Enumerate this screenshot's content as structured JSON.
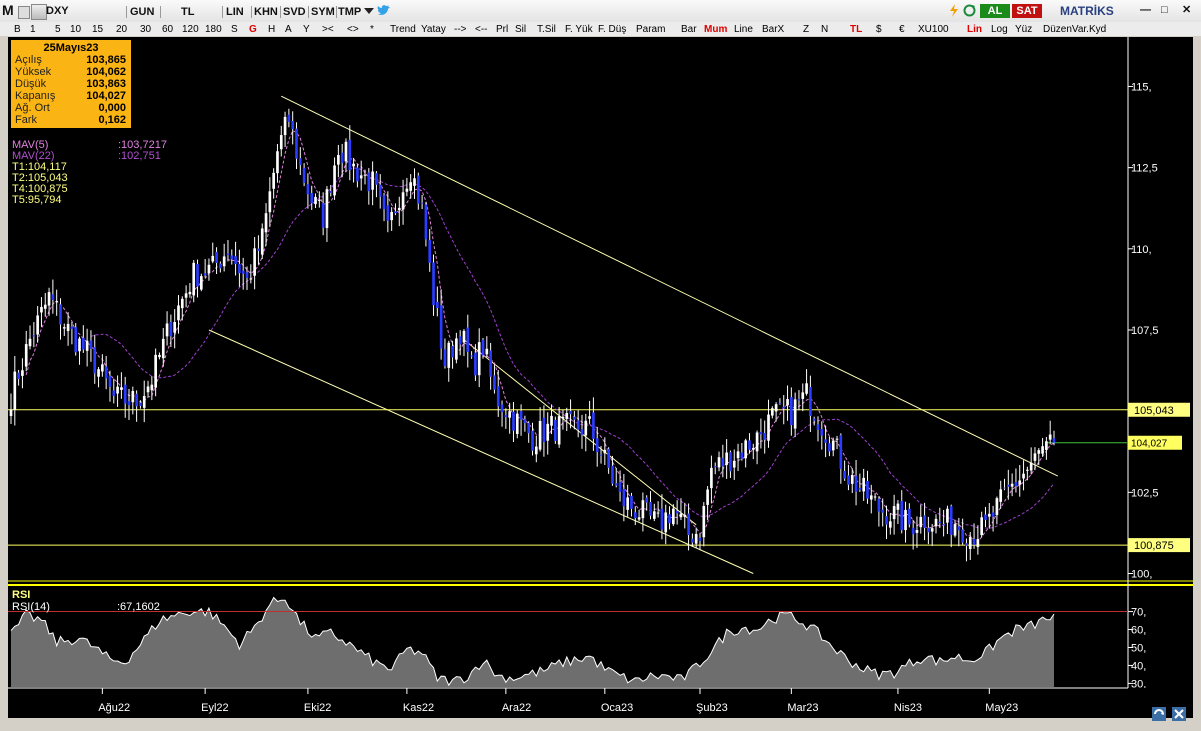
{
  "app": {
    "name": "MATRİKS",
    "symbol": "DXY",
    "period": "GUN",
    "currency": "TL",
    "scale": "LIN"
  },
  "titlebar_buttons": [
    "GUN",
    "TL",
    "LIN",
    "KHN",
    "SVD",
    "SYM",
    "TMP"
  ],
  "trade": {
    "buy": "AL",
    "sell": "SAT"
  },
  "window_controls": {
    "minimize": "—",
    "maximize": "□",
    "close": "✕"
  },
  "toolbar": [
    "B",
    "1",
    "5",
    "10",
    "15",
    "20",
    "30",
    "60",
    "120",
    "180",
    "S",
    "G",
    "H",
    "A",
    "Y",
    ">< ",
    "<>",
    "*",
    "Trend",
    "Yatay",
    "-->",
    "<--",
    "Prl",
    "Sil",
    "T.Sil",
    "F. Yük",
    "F. Düş",
    "Param",
    "Bar",
    "Mum",
    "Line",
    "BarX",
    "Z",
    "N",
    "TL",
    "$",
    "€",
    "XU100",
    "Lin",
    "Log",
    "Yüz",
    "DüzenVar.Kyd"
  ],
  "toolbar_colors": {
    "active_red": "#e00000",
    "accent_green": "#00a000",
    "accent_red": "#c00000"
  },
  "ohlc": {
    "date": "25Mayıs23",
    "rows": [
      {
        "label": "Açılış",
        "value": "103,865"
      },
      {
        "label": "Yüksek",
        "value": "104,062"
      },
      {
        "label": "Düşük",
        "value": "103,863"
      },
      {
        "label": "Kapanış",
        "value": "104,027"
      },
      {
        "label": "Ağ. Ort",
        "value": "0,000"
      },
      {
        "label": "Fark",
        "value": "0,162"
      }
    ]
  },
  "indicators": {
    "mav5": {
      "label": "MAV(5)",
      "value": ":103,7217",
      "color": "#e080e0"
    },
    "mav22": {
      "label": "MAV(22)",
      "value": ":102,751",
      "color": "#b050d0"
    },
    "targets": [
      "T1:104,117",
      "T2:105,043",
      "T4:100,875",
      "T5:95,794"
    ]
  },
  "chart_data": {
    "type": "candlestick",
    "symbol": "DXY",
    "ylim": [
      99.8,
      116.4
    ],
    "yticks": [
      "115,",
      "112,5",
      "110,",
      "107,5",
      "105,",
      "102,5",
      "100,"
    ],
    "ytick_values": [
      115,
      112.5,
      110,
      107.5,
      105,
      102.5,
      100
    ],
    "xticks": [
      "Ağu22",
      "Eyl22",
      "Eki22",
      "Kas22",
      "Ara22",
      "Oca23",
      "Şub23",
      "Mar23",
      "Nis23",
      "May23"
    ],
    "xtick_index": [
      24,
      51,
      78,
      104,
      130,
      156,
      181,
      205,
      233,
      257
    ],
    "num_bars": 275,
    "last_close": "104,027",
    "levels": [
      {
        "label": "105,043",
        "value": 105.043
      },
      {
        "label": "100,875",
        "value": 100.875
      }
    ],
    "key_points": [
      [
        0,
        105.5
      ],
      [
        5,
        107.2
      ],
      [
        10,
        108.5
      ],
      [
        15,
        107.5
      ],
      [
        22,
        106.5
      ],
      [
        27,
        105.4
      ],
      [
        33,
        105.3
      ],
      [
        37,
        106.0
      ],
      [
        42,
        107.7
      ],
      [
        48,
        109.2
      ],
      [
        53,
        109.4
      ],
      [
        57,
        110.0
      ],
      [
        62,
        109.0
      ],
      [
        66,
        110.3
      ],
      [
        70,
        113.0
      ],
      [
        73,
        114.0
      ],
      [
        76,
        112.5
      ],
      [
        79,
        111.5
      ],
      [
        82,
        111.0
      ],
      [
        86,
        113.2
      ],
      [
        90,
        112.5
      ],
      [
        95,
        112.0
      ],
      [
        99,
        110.5
      ],
      [
        102,
        111.7
      ],
      [
        105,
        112.5
      ],
      [
        108,
        111.2
      ],
      [
        111,
        108.5
      ],
      [
        114,
        106.5
      ],
      [
        118,
        107.5
      ],
      [
        121,
        106.3
      ],
      [
        124,
        107.0
      ],
      [
        127,
        105.5
      ],
      [
        132,
        104.8
      ],
      [
        137,
        104.2
      ],
      [
        142,
        104.5
      ],
      [
        146,
        104.5
      ],
      [
        152,
        104.5
      ],
      [
        157,
        103.2
      ],
      [
        160,
        102.3
      ],
      [
        165,
        101.9
      ],
      [
        170,
        101.5
      ],
      [
        174,
        102.0
      ],
      [
        178,
        101.2
      ],
      [
        181,
        101.3
      ],
      [
        184,
        103.2
      ],
      [
        188,
        103.5
      ],
      [
        192,
        103.8
      ],
      [
        196,
        104.2
      ],
      [
        200,
        104.8
      ],
      [
        205,
        105.0
      ],
      [
        209,
        105.5
      ],
      [
        212,
        104.8
      ],
      [
        216,
        104.0
      ],
      [
        220,
        103.0
      ],
      [
        224,
        102.5
      ],
      [
        228,
        102.0
      ],
      [
        232,
        101.8
      ],
      [
        236,
        101.5
      ],
      [
        240,
        101.7
      ],
      [
        244,
        101.5
      ],
      [
        248,
        101.6
      ],
      [
        252,
        101.2
      ],
      [
        256,
        101.4
      ],
      [
        259,
        102.0
      ],
      [
        263,
        102.7
      ],
      [
        267,
        103.2
      ],
      [
        271,
        103.8
      ],
      [
        274,
        104.0
      ]
    ],
    "trendlines": [
      {
        "name": "upper",
        "from": [
          71,
          114.7
        ],
        "to": [
          275,
          103.0
        ]
      },
      {
        "name": "channel-top",
        "from": [
          119,
          107.2
        ],
        "to": [
          180,
          101.5
        ]
      },
      {
        "name": "channel-bottom",
        "from": [
          52,
          107.5
        ],
        "to": [
          195,
          100.0
        ]
      }
    ],
    "rsi": {
      "label": "RSI(14)",
      "value": ":67,1602",
      "ylim": [
        28,
        82
      ],
      "yticks": [
        "70,",
        "60,",
        "50,",
        "40,",
        "30,"
      ],
      "ytick_values": [
        70,
        60,
        50,
        40,
        30
      ],
      "overbought": 70,
      "key_points": [
        [
          0,
          57
        ],
        [
          4,
          68
        ],
        [
          8,
          65
        ],
        [
          12,
          53
        ],
        [
          18,
          55
        ],
        [
          22,
          50
        ],
        [
          26,
          43
        ],
        [
          30,
          42
        ],
        [
          34,
          52
        ],
        [
          39,
          65
        ],
        [
          43,
          68
        ],
        [
          47,
          70
        ],
        [
          52,
          70
        ],
        [
          56,
          62
        ],
        [
          60,
          52
        ],
        [
          64,
          61
        ],
        [
          68,
          74
        ],
        [
          72,
          78
        ],
        [
          76,
          64
        ],
        [
          80,
          55
        ],
        [
          84,
          58
        ],
        [
          88,
          53
        ],
        [
          92,
          47
        ],
        [
          96,
          41
        ],
        [
          100,
          38
        ],
        [
          104,
          49
        ],
        [
          108,
          47
        ],
        [
          112,
          33
        ],
        [
          116,
          31
        ],
        [
          120,
          34
        ],
        [
          124,
          43
        ],
        [
          128,
          34
        ],
        [
          132,
          33
        ],
        [
          136,
          35
        ],
        [
          140,
          37
        ],
        [
          144,
          41
        ],
        [
          148,
          43
        ],
        [
          152,
          45
        ],
        [
          156,
          38
        ],
        [
          160,
          34
        ],
        [
          164,
          31
        ],
        [
          168,
          34
        ],
        [
          172,
          34
        ],
        [
          176,
          32
        ],
        [
          180,
          39
        ],
        [
          184,
          48
        ],
        [
          188,
          58
        ],
        [
          192,
          61
        ],
        [
          196,
          60
        ],
        [
          200,
          66
        ],
        [
          204,
          68
        ],
        [
          208,
          64
        ],
        [
          212,
          58
        ],
        [
          216,
          50
        ],
        [
          220,
          43
        ],
        [
          224,
          38
        ],
        [
          228,
          35
        ],
        [
          232,
          36
        ],
        [
          236,
          41
        ],
        [
          240,
          45
        ],
        [
          244,
          42
        ],
        [
          248,
          45
        ],
        [
          252,
          43
        ],
        [
          256,
          47
        ],
        [
          260,
          55
        ],
        [
          264,
          60
        ],
        [
          268,
          62
        ],
        [
          272,
          66
        ],
        [
          274,
          67
        ]
      ]
    }
  },
  "colors": {
    "background": "#000000",
    "up_body": "#ffffff",
    "down_body": "#2a3cff",
    "wick": "#ffffff",
    "trendline": "#ffffb4",
    "level": "#ffff60",
    "last_price_line": "#40c040",
    "ma5": "#e080e0",
    "ma22": "#a040d0",
    "rsi_fill": "#6e6e6e",
    "rsi_line": "#ffffff",
    "rsi_ob_line": "#c03030",
    "axis_text": "#ffffff",
    "panel_sep": "#ffff00",
    "title_yellow": "#ffff80"
  },
  "status_icons": [
    "refresh-icon",
    "network-icon"
  ]
}
